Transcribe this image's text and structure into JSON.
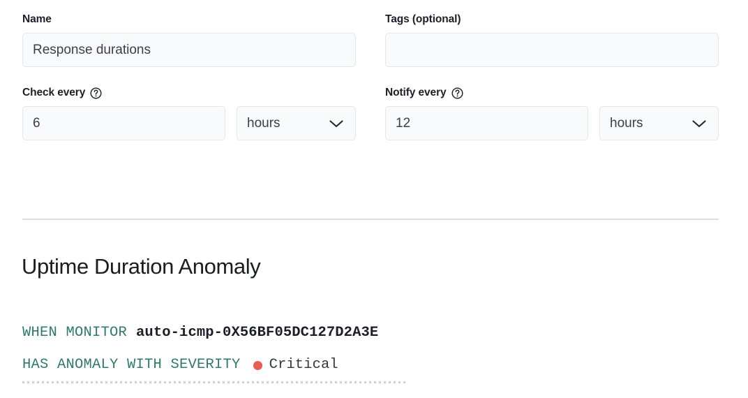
{
  "form": {
    "fields": [
      {
        "label": "Name",
        "help_icon": null,
        "value": "Response durations",
        "placeholder": ""
      },
      {
        "label": "Tags (optional)",
        "help_icon": null,
        "value": "",
        "placeholder": ""
      },
      {
        "label": "Check every",
        "help_icon": "help-circle-icon",
        "value": "6",
        "placeholder": "",
        "unit": "hours",
        "unit_icon": "chevron-down-icon"
      },
      {
        "label": "Notify every",
        "help_icon": "help-circle-icon",
        "value": "12",
        "placeholder": "",
        "unit": "hours",
        "unit_icon": "chevron-down-icon"
      }
    ]
  },
  "section": {
    "title": "Uptime Duration Anomaly"
  },
  "rule": {
    "line1": {
      "keyword": "WHEN MONITOR",
      "value": "auto-icmp-0X56BF05DC127D2A3E"
    },
    "line2": {
      "keyword": "HAS ANOMALY WITH SEVERITY",
      "severity": "Critical",
      "severity_dot": "severity-dot-icon"
    }
  },
  "colors": {
    "keyword_teal": "#2e7a6b",
    "severity_critical": "#e85c53",
    "input_bg": "#f8fafc",
    "input_border": "#e3e7ee",
    "divider": "#dcdfe7",
    "text_primary": "#1c1f26"
  }
}
